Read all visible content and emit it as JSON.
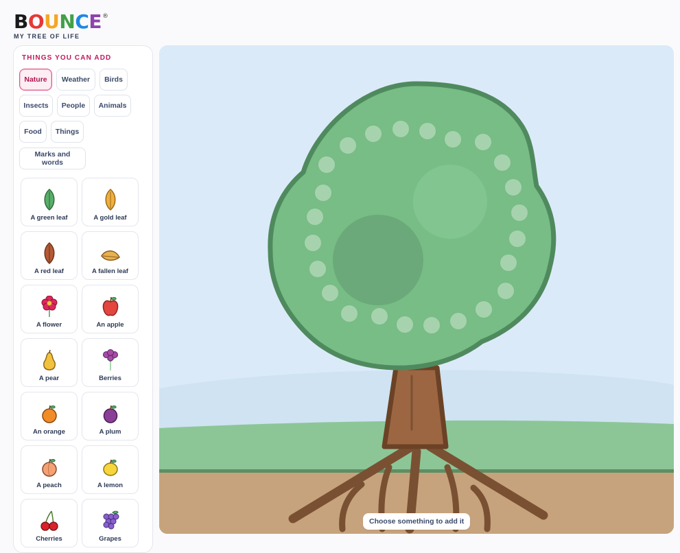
{
  "logo": {
    "letters": [
      "B",
      "O",
      "U",
      "N",
      "C",
      "E"
    ],
    "reg": "®",
    "subtitle": "MY TREE OF LIFE"
  },
  "sidebar": {
    "title": "THINGS YOU CAN ADD",
    "categories": [
      {
        "label": "Nature",
        "active": true
      },
      {
        "label": "Weather",
        "active": false
      },
      {
        "label": "Birds",
        "active": false
      },
      {
        "label": "Insects",
        "active": false
      },
      {
        "label": "People",
        "active": false
      },
      {
        "label": "Animals",
        "active": false
      },
      {
        "label": "Food",
        "active": false
      },
      {
        "label": "Things",
        "active": false
      },
      {
        "label": "Marks and words",
        "active": false
      }
    ],
    "items": [
      {
        "label": "A green leaf",
        "icon": "green-leaf-icon"
      },
      {
        "label": "A gold leaf",
        "icon": "gold-leaf-icon"
      },
      {
        "label": "A red leaf",
        "icon": "red-leaf-icon"
      },
      {
        "label": "A fallen leaf",
        "icon": "fallen-leaf-icon"
      },
      {
        "label": "A flower",
        "icon": "flower-icon"
      },
      {
        "label": "An apple",
        "icon": "apple-icon"
      },
      {
        "label": "A pear",
        "icon": "pear-icon"
      },
      {
        "label": "Berries",
        "icon": "berries-icon"
      },
      {
        "label": "An orange",
        "icon": "orange-icon"
      },
      {
        "label": "A plum",
        "icon": "plum-icon"
      },
      {
        "label": "A peach",
        "icon": "peach-icon"
      },
      {
        "label": "A lemon",
        "icon": "lemon-icon"
      },
      {
        "label": "Cherries",
        "icon": "cherries-icon"
      },
      {
        "label": "Grapes",
        "icon": "grapes-icon"
      }
    ]
  },
  "canvas": {
    "hint": "Choose something to add it"
  },
  "colors": {
    "accent": "#c2185b",
    "sky": "#dbeaf8",
    "foliage": "#77bd85",
    "foliage_outline": "#4f8a5e",
    "trunk": "#9c6642",
    "ground": "#c7a37d",
    "grass": "#8cc697"
  }
}
